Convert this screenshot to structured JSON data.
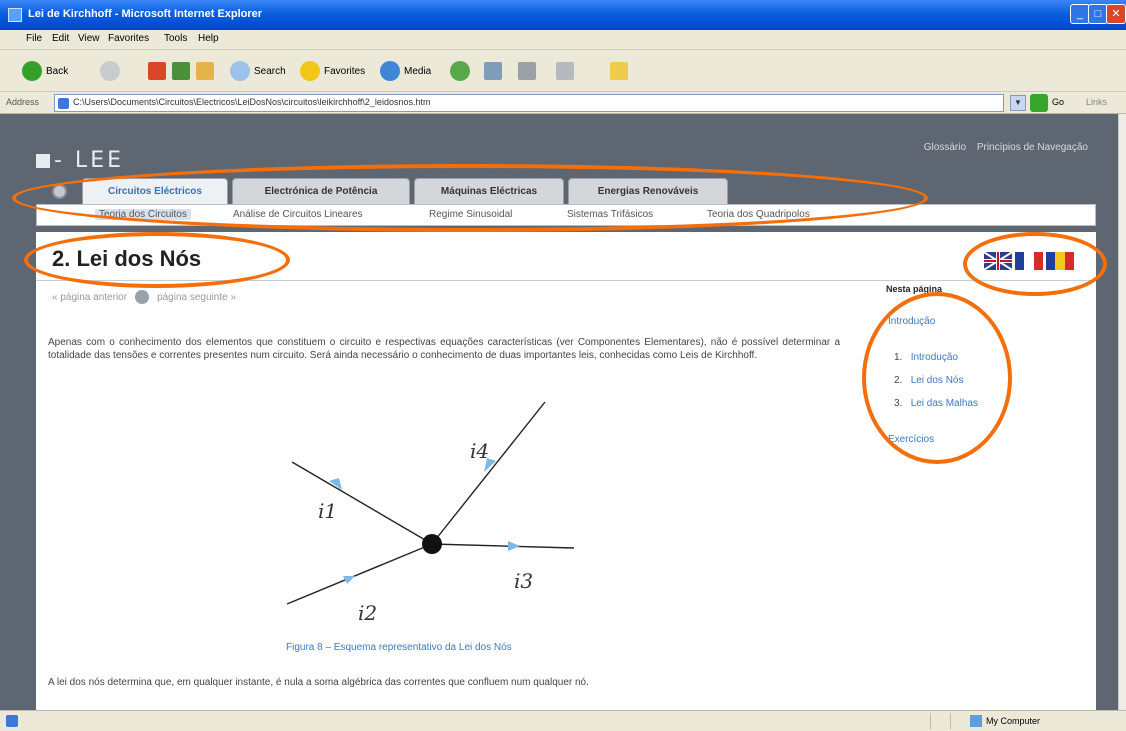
{
  "window": {
    "title": "Lei de Kirchhoff - Microsoft Internet Explorer",
    "min": "_",
    "max": "□",
    "close": "✕"
  },
  "menu": [
    "File",
    "Edit",
    "View",
    "Favorites",
    "Tools",
    "Help"
  ],
  "toolbar": {
    "back": "Back",
    "search": "Search",
    "favorites": "Favorites",
    "media": "Media"
  },
  "address": {
    "label": "Address",
    "url": "C:\\Users\\Documents\\Circuitos\\Electricos\\LeiDosNos\\circuitos\\leikirchhoff\\2_leidosnos.htm",
    "go": "Go",
    "links": "Links"
  },
  "site": {
    "logo": "- LEE",
    "top_links": [
      "Glossário",
      "Princípios de Navegação"
    ]
  },
  "tabs": [
    "Circuitos Eléctricos",
    "Electrónica de Potência",
    "Máquinas Eléctricas",
    "Energias Renováveis"
  ],
  "subnav": [
    "Teoria dos Circuitos",
    "Análise de Circuitos Lineares",
    "Regime Sinusoidal",
    "Sistemas Trifásicos",
    "Teoria dos Quadripolos"
  ],
  "page": {
    "title": "2. Lei dos Nós",
    "prev": "« página anterior",
    "next": "página seguinte »",
    "intro": "Apenas com o conhecimento dos elementos que constituem o circuito e respectivas equações características (ver Componentes Elementares), não é possível determinar a totalidade das tensões e correntes presentes num circuito. Será ainda necessário o conhecimento de duas importantes leis, conhecidas como Leis de Kirchhoff.",
    "caption": "Figura 8 – Esquema representativo da Lei dos Nós",
    "outro": "A lei dos nós determina que, em qualquer instante, é nula a soma algébrica das correntes que confluem num qualquer nó."
  },
  "figure": {
    "labels": [
      "i1",
      "i2",
      "i3",
      "i4"
    ]
  },
  "sidebar": {
    "heading": "Nesta página",
    "intro_link": "Introdução",
    "items": [
      {
        "num": "1.",
        "label": "Introdução"
      },
      {
        "num": "2.",
        "label": "Lei dos Nós"
      },
      {
        "num": "3.",
        "label": "Lei das Malhas"
      }
    ],
    "exercises": "Exercícios"
  },
  "status": {
    "zone": "My Computer"
  },
  "colors": {
    "annotation": "#f46f0c",
    "link": "#3b78c4",
    "page_bg": "#5d6671"
  }
}
